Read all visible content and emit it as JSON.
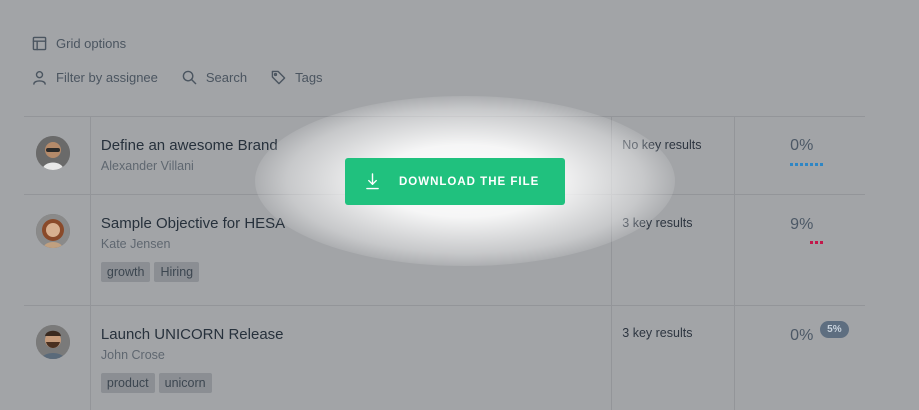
{
  "toolbar": {
    "grid_options": "Grid options",
    "filter_by_assignee": "Filter by assignee",
    "search": "Search",
    "tags": "Tags"
  },
  "cta": {
    "download_label": "DOWNLOAD THE FILE",
    "color": "#20c17e"
  },
  "objectives": [
    {
      "title": "Define an awesome Brand",
      "owner": "Alexander Villani",
      "tags": [],
      "key_results": "No key results",
      "progress": "0%",
      "progress_color": "#2f86c4"
    },
    {
      "title": "Sample Objective for HESA",
      "owner": "Kate Jensen",
      "tags": [
        "growth",
        "Hiring"
      ],
      "key_results": "3 key results",
      "progress": "9%",
      "progress_color": "#c2184b"
    },
    {
      "title": "Launch UNICORN Release",
      "owner": "John Crose",
      "tags": [
        "product",
        "unicorn"
      ],
      "key_results": "3 key results",
      "progress": "0%",
      "badge": "5%"
    }
  ]
}
